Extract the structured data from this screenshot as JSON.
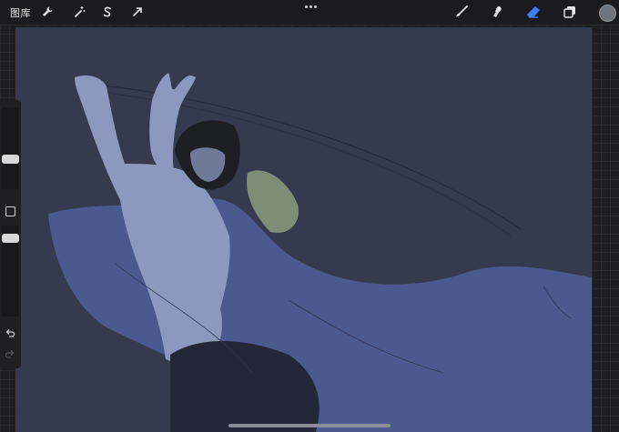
{
  "topbar": {
    "gallery_label": "图库",
    "left_tools": [
      "wrench-icon",
      "magic-wand-icon",
      "selection-s-icon",
      "transform-arrow-icon"
    ],
    "right_tools": [
      "brush-icon",
      "smudge-icon",
      "eraser-icon",
      "layers-icon"
    ],
    "active_tool": "eraser-icon",
    "active_tool_color": "#3d7ef5",
    "current_color": "#6d747c"
  },
  "canvas": {
    "background_color": "#343b4f",
    "cloak_color": "#4b5a8e",
    "figure_color": "#8c98bd"
  },
  "sidebar": {
    "brush_size": 0.35,
    "brush_opacity": 0.9,
    "icons": [
      "modify-square-icon",
      "undo-icon",
      "redo-icon"
    ]
  }
}
